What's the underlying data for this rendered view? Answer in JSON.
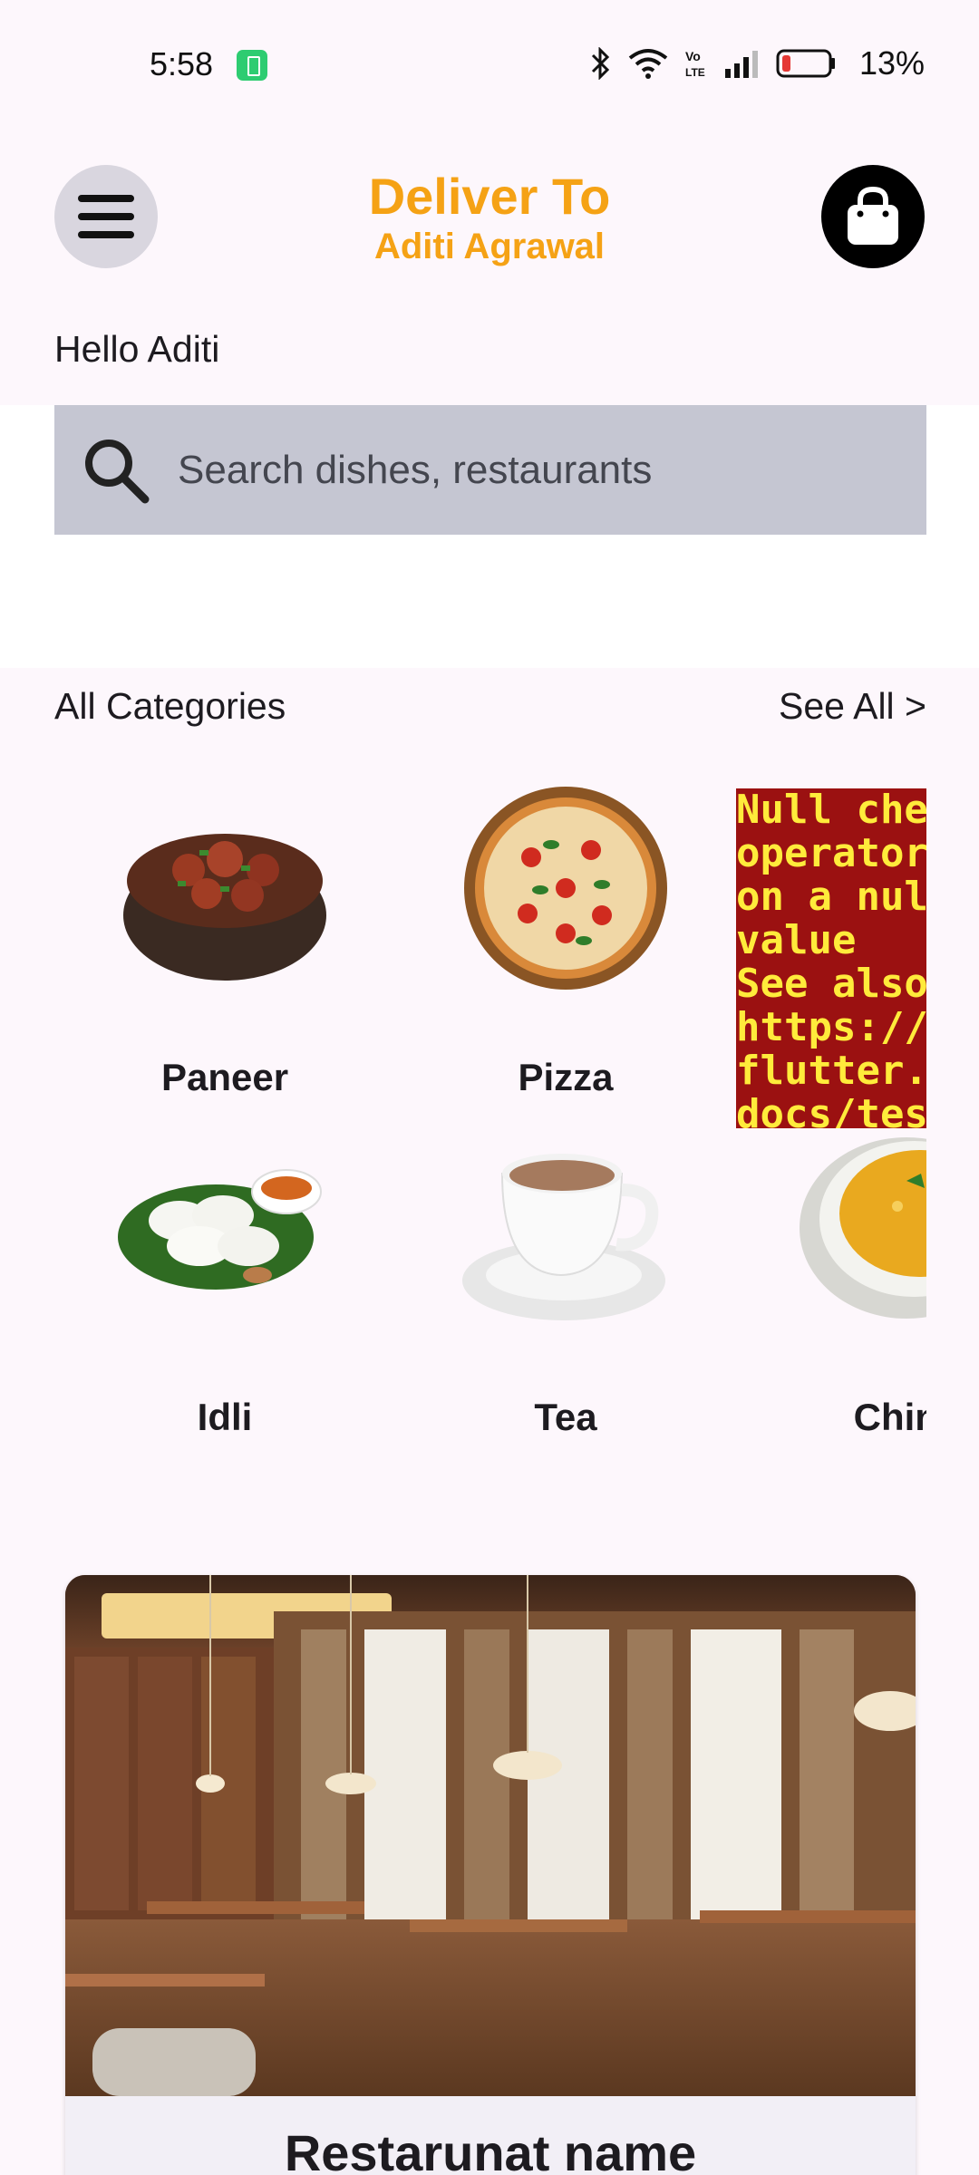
{
  "status_bar": {
    "time": "5:58",
    "battery_percent": "13%"
  },
  "header": {
    "deliver_title": "Deliver To",
    "deliver_name": "Aditi Agrawal",
    "greeting": "Hello Aditi"
  },
  "search": {
    "placeholder": "Search dishes, restaurants"
  },
  "categories": {
    "title": "All Categories",
    "see_all": "See All >",
    "items": [
      {
        "label": "Paneer",
        "icon": "paneer-bowl-icon"
      },
      {
        "label": "Pizza",
        "icon": "pizza-icon"
      },
      {
        "label": "Idli",
        "icon": "idli-plate-icon"
      },
      {
        "label": "Tea",
        "icon": "tea-cup-icon"
      },
      {
        "label": "Chine",
        "icon": "soup-bowl-icon"
      }
    ],
    "error_text": "Null chec\noperator\non a null\nvalue\nSee also\nhttps://\nflutter.d\ndocs/test\nerrors"
  },
  "restaurant_card": {
    "name": "Restarunat name"
  },
  "colors": {
    "accent": "#f5a215",
    "background": "#fdf7fc",
    "search_bg": "#c5c6d2",
    "error_bg": "#9b1111",
    "error_text": "#ffeb3b"
  }
}
